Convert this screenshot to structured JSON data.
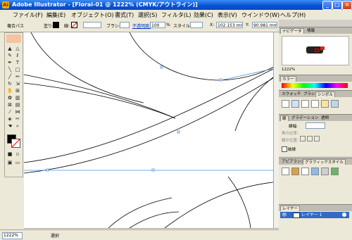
{
  "window": {
    "title": "Adobe Illustrator - [Floral-01 @ 1222% (CMYK/アウトライン)]",
    "icon_label": "Ai",
    "controls": {
      "minimize": "_",
      "maximize": "□",
      "close": "×"
    }
  },
  "menubar": {
    "items": [
      "ファイル(F)",
      "編集(E)",
      "オブジェクト(O)",
      "書式(T)",
      "選択(S)",
      "フィルタ(L)",
      "効果(C)",
      "表示(V)",
      "ウインドウ(W)",
      "ヘルプ(H)"
    ]
  },
  "options_bar": {
    "selection_type": "複合パス",
    "fill_label": "塗り:",
    "stroke_label": "線:",
    "brush_label": "ブラシ:",
    "opacity_link": "不透明度:",
    "opacity_value": "100",
    "opacity_unit": "%",
    "style_label": "スタイル:",
    "x_label": "X:",
    "x_value": "102.153 mm",
    "y_label": "Y:",
    "y_value": "90.981 mm"
  },
  "toolbox": {
    "tools": [
      "selection",
      "direct-selection",
      "magic-wand",
      "lasso",
      "pen",
      "type",
      "line",
      "rectangle",
      "paintbrush",
      "pencil",
      "rotate",
      "scale",
      "warp",
      "free-transform",
      "symbol-sprayer",
      "column-graph",
      "mesh",
      "gradient",
      "eyedropper",
      "blend",
      "live-paint",
      "slice",
      "hand",
      "zoom"
    ],
    "fill_color": "#000000",
    "stroke_color": "#ffffff"
  },
  "status_bar": {
    "zoom": "1222%",
    "status_text": "選択"
  },
  "panels": {
    "navigator": {
      "tabs": [
        "ナビゲータ",
        "情報"
      ],
      "zoom": "1222%"
    },
    "color": {
      "tabs": [
        "カラー"
      ]
    },
    "swatches": {
      "tabs": [
        "スウォッチ",
        "ブラシ",
        "シンボル"
      ]
    },
    "stroke": {
      "tabs": [
        "線",
        "グラデーション",
        "透明"
      ],
      "weight_label": "線幅:",
      "cap_label": "角の比率:",
      "join_label": "線の位置:",
      "dashed_label": "破線"
    },
    "appearance": {
      "tabs": [
        "アピアランス",
        "グラフィックスタイル"
      ]
    },
    "layers": {
      "tabs": [
        "レイヤー"
      ],
      "layer_name": "レイヤー 1"
    }
  },
  "colors": {
    "titlebar": "#0a54d6",
    "selection": "#4a90d9",
    "layer_highlight": "#316ac5"
  }
}
